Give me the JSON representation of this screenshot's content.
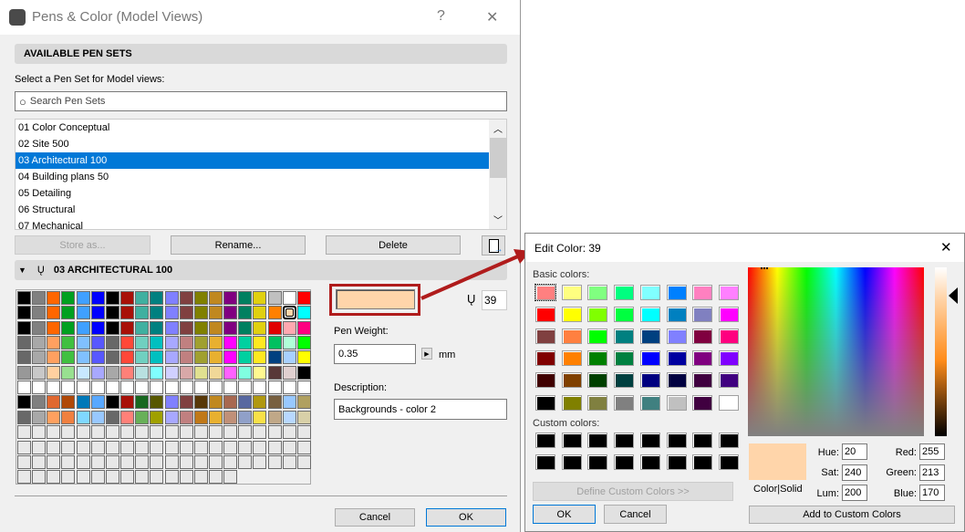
{
  "main": {
    "title": "Pens & Color (Model Views)",
    "help": "?",
    "close": "✕",
    "section1": "AVAILABLE PEN SETS",
    "select_label": "Select a Pen Set for Model views:",
    "search_placeholder": "Search Pen Sets",
    "pen_sets": [
      "01 Color Conceptual",
      "02 Site 500",
      "03 Architectural 100",
      "04 Building plans 50",
      "05 Detailing",
      "06 Structural",
      "07 Mechanical"
    ],
    "selected_index": 2,
    "store_as": "Store as...",
    "rename": "Rename...",
    "delete": "Delete",
    "section2": "03 ARCHITECTURAL 100",
    "pen_number": "39",
    "selected_color": "#ffd5aa",
    "pen_weight_label": "Pen Weight:",
    "pen_weight": "0.35",
    "unit": "mm",
    "description_label": "Description:",
    "description": "Backgrounds - color 2",
    "cancel": "Cancel",
    "ok": "OK",
    "pen_colors": [
      [
        "#000000",
        "#808080",
        "#ff6600",
        "#00a020",
        "#40a0ff",
        "#0000ff",
        "#000000",
        "#a81008",
        "#40b0a0",
        "#008080",
        "#8080ff",
        "#804040",
        "#808000",
        "#c08820",
        "#800080",
        "#008060",
        "#e0d010",
        "#c0c0c0",
        "#ffffff",
        "#ff0000"
      ],
      [
        "#000000",
        "#808080",
        "#ff6600",
        "#00a020",
        "#40a0ff",
        "#0000ff",
        "#000000",
        "#a81008",
        "#40b0a0",
        "#008080",
        "#8080ff",
        "#804040",
        "#808000",
        "#c08820",
        "#800080",
        "#008060",
        "#e0d010",
        "#ff8000",
        "#ffd5aa",
        "#00ffff"
      ],
      [
        "#000000",
        "#808080",
        "#ff6600",
        "#00a020",
        "#40a0ff",
        "#0000ff",
        "#000000",
        "#a81008",
        "#40b0a0",
        "#008080",
        "#8080ff",
        "#804040",
        "#808000",
        "#c08820",
        "#800080",
        "#008060",
        "#e0d010",
        "#e00000",
        "#ffa8b0",
        "#ff0080"
      ],
      [
        "#686868",
        "#a8a8a8",
        "#ffa060",
        "#40c040",
        "#80c0ff",
        "#5858ff",
        "#686868",
        "#ff4838",
        "#70d0c0",
        "#00c0c0",
        "#a8a8ff",
        "#c08080",
        "#a0a030",
        "#e8b030",
        "#ff00ff",
        "#00d0a0",
        "#ffe820",
        "#00c060",
        "#b0ffd8",
        "#00ff00"
      ],
      [
        "#686868",
        "#a8a8a8",
        "#ffa060",
        "#40c040",
        "#80c0ff",
        "#5858ff",
        "#686868",
        "#ff4838",
        "#70d0c0",
        "#00c0c0",
        "#a8a8ff",
        "#c08080",
        "#a0a030",
        "#e8b030",
        "#ff00ff",
        "#00d0a0",
        "#ffe820",
        "#004080",
        "#a8d0ff",
        "#ffff00"
      ],
      [
        "#989898",
        "#c8c8c8",
        "#ffd0a0",
        "#98e090",
        "#c8e8ff",
        "#a8a8ff",
        "#a8a8a8",
        "#ff8078",
        "#b8e0e0",
        "#80ffff",
        "#d0d0ff",
        "#d8a8a8",
        "#e0e090",
        "#f0d898",
        "#ff60ff",
        "#80ffe0",
        "#fff890",
        "#583838",
        "#e0d0d0",
        "#000000"
      ],
      [
        "#ffffff",
        "#ffffff",
        "#ffffff",
        "#ffffff",
        "#ffffff",
        "#ffffff",
        "#ffffff",
        "#ffffff",
        "#ffffff",
        "#ffffff",
        "#ffffff",
        "#ffffff",
        "#ffffff",
        "#ffffff",
        "#ffffff",
        "#ffffff",
        "#ffffff",
        "#ffffff",
        "#ffffff",
        "#ffffff"
      ],
      [
        "#000000",
        "#808080",
        "#e06830",
        "#b04808",
        "#0078b8",
        "#58a8ff",
        "#000000",
        "#a81008",
        "#186820",
        "#585800",
        "#8080ff",
        "#804040",
        "#583808",
        "#c08820",
        "#a86850",
        "#5868a0",
        "#b09810",
        "#786040",
        "#98c8ff",
        "#b0a060"
      ],
      [
        "#686868",
        "#a8a8a8",
        "#ffa060",
        "#f08040",
        "#80d8ff",
        "#98c8ff",
        "#686868",
        "#ff8078",
        "#68b058",
        "#a0a000",
        "#a8a8ff",
        "#c08080",
        "#c07818",
        "#e8b030",
        "#c09078",
        "#90a0c8",
        "#f8e048",
        "#c0a888",
        "#b8d8ff",
        "#d8d0a8"
      ]
    ],
    "empty_pen_rows": 4,
    "empty_last_row_count": 15,
    "selected_pen": [
      1,
      18
    ]
  },
  "color_dialog": {
    "title": "Edit Color:  39",
    "close": "✕",
    "basic_label": "Basic colors:",
    "basic": [
      "#ff8080",
      "#ffff80",
      "#80ff80",
      "#00ff80",
      "#80ffff",
      "#0080ff",
      "#ff80c0",
      "#ff80ff",
      "#ff0000",
      "#ffff00",
      "#80ff00",
      "#00ff40",
      "#00ffff",
      "#0080c0",
      "#8080c0",
      "#ff00ff",
      "#804040",
      "#ff8040",
      "#00ff00",
      "#008080",
      "#004080",
      "#8080ff",
      "#800040",
      "#ff0080",
      "#800000",
      "#ff8000",
      "#008000",
      "#008040",
      "#0000ff",
      "#0000a0",
      "#800080",
      "#8000ff",
      "#400000",
      "#804000",
      "#004000",
      "#004040",
      "#000080",
      "#000040",
      "#400040",
      "#400080",
      "#000000",
      "#808000",
      "#808040",
      "#808080",
      "#408080",
      "#c0c0c0",
      "#400040",
      "#ffffff"
    ],
    "custom_label": "Custom colors:",
    "custom": [
      "#000000",
      "#000000",
      "#000000",
      "#000000",
      "#000000",
      "#000000",
      "#000000",
      "#000000",
      "#000000",
      "#000000",
      "#000000",
      "#000000",
      "#000000",
      "#000000",
      "#000000",
      "#000000"
    ],
    "define": "Define Custom Colors >>",
    "ok": "OK",
    "cancel": "Cancel",
    "color_solid": "Color|Solid",
    "hue_label": "Hue:",
    "hue": "20",
    "sat_label": "Sat:",
    "sat": "240",
    "lum_label": "Lum:",
    "lum": "200",
    "red_label": "Red:",
    "red": "255",
    "green_label": "Green:",
    "green": "213",
    "blue_label": "Blue:",
    "blue": "170",
    "add_custom": "Add to Custom Colors",
    "color": "#ffd5aa"
  }
}
